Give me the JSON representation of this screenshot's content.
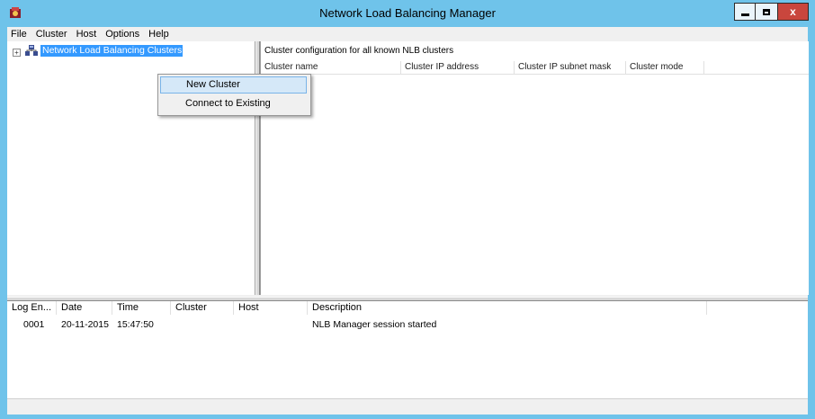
{
  "window": {
    "title": "Network Load Balancing Manager",
    "close_glyph": "x",
    "colors": {
      "frame": "#6fc3ea",
      "close": "#c9463d",
      "selection": "#3399ff",
      "menu_hover": "#d5e8f8"
    }
  },
  "menubar": {
    "items": [
      "File",
      "Cluster",
      "Host",
      "Options",
      "Help"
    ]
  },
  "tree": {
    "expander": "+",
    "root_label": "Network Load Balancing Clusters",
    "root_icon": "network-cluster-icon"
  },
  "context_menu": {
    "items": [
      "New Cluster",
      "Connect to Existing"
    ]
  },
  "right_pane": {
    "caption": "Cluster configuration for all known NLB clusters",
    "columns": [
      "Cluster name",
      "Cluster IP address",
      "Cluster IP subnet mask",
      "Cluster mode"
    ]
  },
  "log": {
    "columns": [
      "Log En...",
      "Date",
      "Time",
      "Cluster",
      "Host",
      "Description"
    ],
    "rows": [
      {
        "entry": "0001",
        "date": "20-11-2015",
        "time": "15:47:50",
        "cluster": "",
        "host": "",
        "description": "NLB Manager session started"
      }
    ]
  }
}
